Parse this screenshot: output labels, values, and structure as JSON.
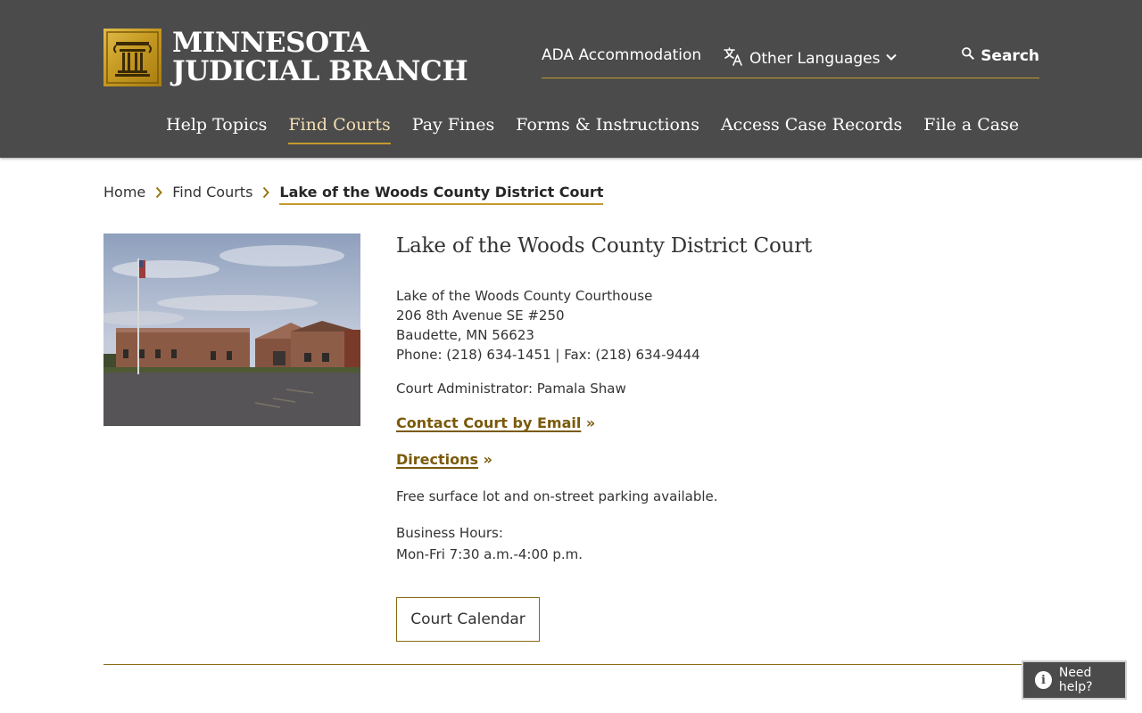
{
  "header": {
    "logo_line1": "MINNESOTA",
    "logo_line2": "JUDICIAL BRANCH",
    "utility": {
      "ada": "ADA Accommodation",
      "languages": "Other Languages",
      "search": "Search"
    },
    "nav": [
      {
        "label": "Help Topics",
        "active": false
      },
      {
        "label": "Find Courts",
        "active": true
      },
      {
        "label": "Pay Fines",
        "active": false
      },
      {
        "label": "Forms & Instructions",
        "active": false
      },
      {
        "label": "Access Case Records",
        "active": false
      },
      {
        "label": "File a Case",
        "active": false
      }
    ]
  },
  "breadcrumb": {
    "home": "Home",
    "section": "Find Courts",
    "current": "Lake of the Woods County District Court"
  },
  "court": {
    "title": "Lake of the Woods County District Court",
    "building": "Lake of the Woods County Courthouse",
    "street": "206 8th Avenue SE #250",
    "city": "Baudette, MN 56623",
    "phone_fax": "Phone: (218) 634-1451 | Fax: (218) 634-9444",
    "administrator": "Court Administrator: Pamala Shaw",
    "email_link": "Contact Court by Email",
    "directions_link": "Directions",
    "link_suffix": "»",
    "parking": "Free surface lot and on-street parking available.",
    "hours_label": "Business Hours:",
    "hours": "Mon-Fri 7:30 a.m.-4:00 p.m.",
    "calendar_button": "Court Calendar"
  },
  "help": {
    "label": "Need help?",
    "icon_glyph": "i"
  },
  "colors": {
    "header_bg": "#4b4b4b",
    "accent_gold": "#c29a2e",
    "link_gold": "#7a5a0a",
    "active_nav": "#f4ddb2"
  }
}
